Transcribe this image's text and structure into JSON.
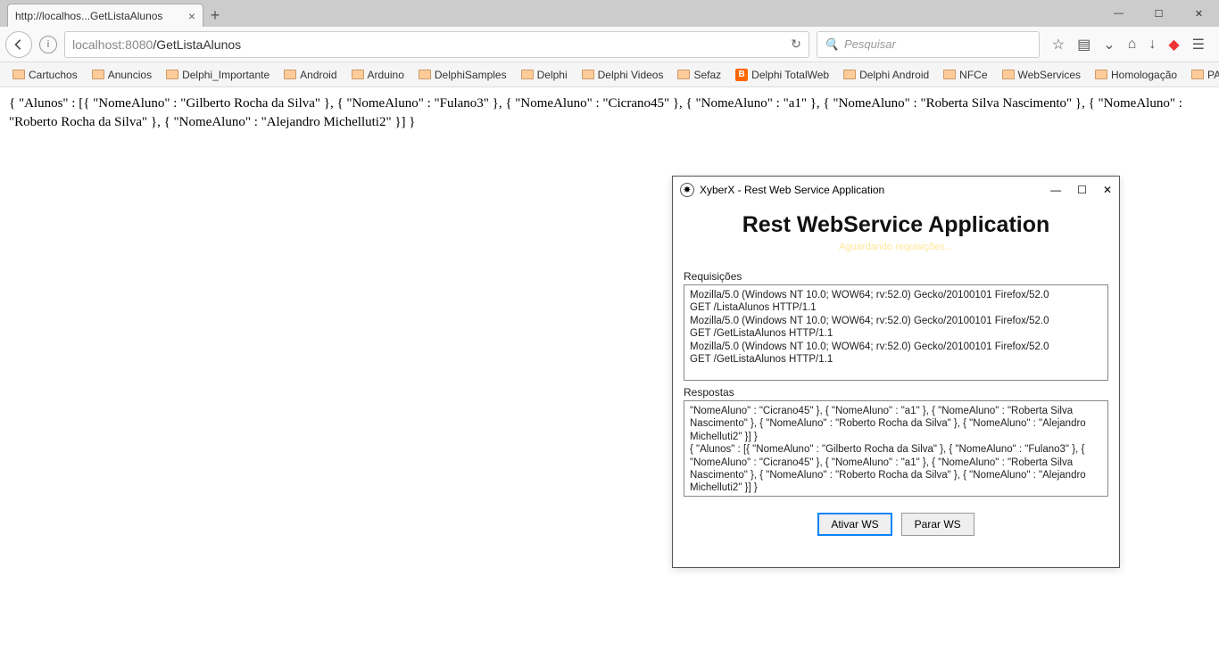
{
  "browser": {
    "tab_title": "http://localhos...GetListaAlunos",
    "url_host": "localhost",
    "url_port": ":8080",
    "url_path": "/GetListaAlunos",
    "search_placeholder": "Pesquisar",
    "bookmarks": [
      {
        "label": "Cartuchos",
        "type": "folder"
      },
      {
        "label": "Anuncios",
        "type": "folder"
      },
      {
        "label": "Delphi_Importante",
        "type": "folder"
      },
      {
        "label": "Android",
        "type": "folder"
      },
      {
        "label": "Arduino",
        "type": "folder"
      },
      {
        "label": "DelphiSamples",
        "type": "folder"
      },
      {
        "label": "Delphi",
        "type": "folder"
      },
      {
        "label": "Delphi Videos",
        "type": "folder"
      },
      {
        "label": "Sefaz",
        "type": "folder"
      },
      {
        "label": "Delphi TotalWeb",
        "type": "blogger"
      },
      {
        "label": "Delphi Android",
        "type": "folder"
      },
      {
        "label": "NFCe",
        "type": "folder"
      },
      {
        "label": "WebServices",
        "type": "folder"
      },
      {
        "label": "Homologação",
        "type": "folder"
      },
      {
        "label": "PAF-ECF",
        "type": "folder"
      }
    ]
  },
  "page_content": "{ \"Alunos\" : [{ \"NomeAluno\" : \"Gilberto Rocha da Silva\" }, { \"NomeAluno\" : \"Fulano3\" }, { \"NomeAluno\" : \"Cicrano45\" }, { \"NomeAluno\" : \"a1\" }, { \"NomeAluno\" : \"Roberta Silva Nascimento\" }, { \"NomeAluno\" : \"Roberto Rocha da Silva\" }, { \"NomeAluno\" : \"Alejandro Michelluti2\" }] }",
  "dialog": {
    "window_title": "XyberX - Rest Web Service Application",
    "heading": "Rest WebService Application",
    "subheading": "Aguardando requisições...",
    "requests_label": "Requisições",
    "requests_text": "Mozilla/5.0 (Windows NT 10.0; WOW64; rv:52.0) Gecko/20100101 Firefox/52.0\nGET /ListaAlunos HTTP/1.1\nMozilla/5.0 (Windows NT 10.0; WOW64; rv:52.0) Gecko/20100101 Firefox/52.0\nGET /GetListaAlunos HTTP/1.1\nMozilla/5.0 (Windows NT 10.0; WOW64; rv:52.0) Gecko/20100101 Firefox/52.0\nGET /GetListaAlunos HTTP/1.1",
    "responses_label": "Respostas",
    "responses_text": "\"NomeAluno\" : \"Cicrano45\" }, { \"NomeAluno\" : \"a1\" }, { \"NomeAluno\" : \"Roberta Silva Nascimento\" }, { \"NomeAluno\" : \"Roberto Rocha da Silva\" }, { \"NomeAluno\" : \"Alejandro Michelluti2\" }] }\n{ \"Alunos\" : [{ \"NomeAluno\" : \"Gilberto Rocha da Silva\" }, { \"NomeAluno\" : \"Fulano3\" }, { \"NomeAluno\" : \"Cicrano45\" }, { \"NomeAluno\" : \"a1\" }, { \"NomeAluno\" : \"Roberta Silva Nascimento\" }, { \"NomeAluno\" : \"Roberto Rocha da Silva\" }, { \"NomeAluno\" : \"Alejandro Michelluti2\" }] }",
    "btn_activate": "Ativar WS",
    "btn_stop": "Parar WS"
  }
}
